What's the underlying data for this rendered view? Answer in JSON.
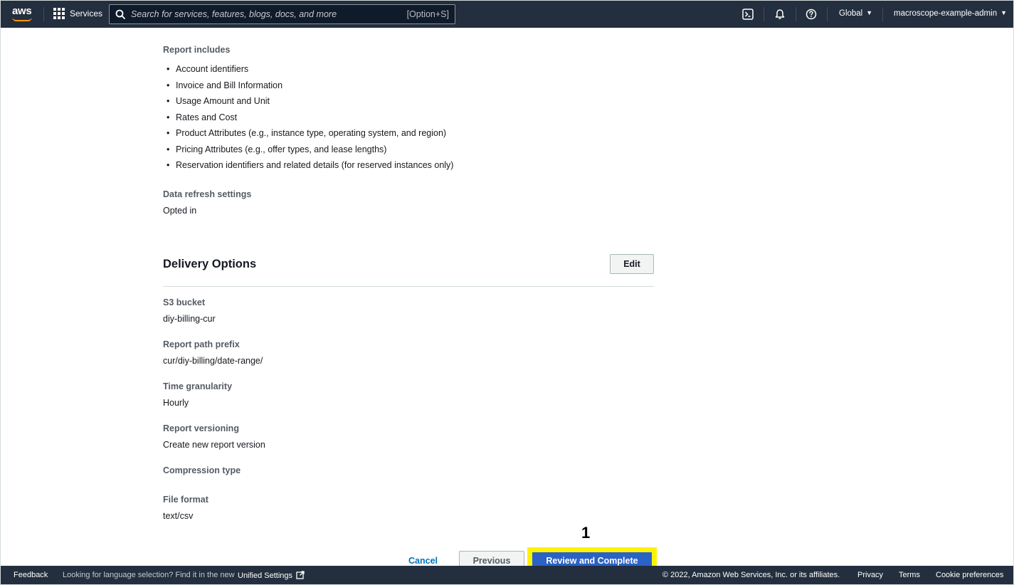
{
  "topnav": {
    "logo_text": "aws",
    "services_label": "Services",
    "search_placeholder": "Search for services, features, blogs, docs, and more",
    "search_shortcut": "[Option+S]",
    "region_label": "Global",
    "account_label": "macroscope-example-admin",
    "icons": [
      "cloudshell-icon",
      "bell-icon",
      "help-icon"
    ]
  },
  "report": {
    "includes_label": "Report includes",
    "includes_items": [
      "Account identifiers",
      "Invoice and Bill Information",
      "Usage Amount and Unit",
      "Rates and Cost",
      "Product Attributes (e.g., instance type, operating system, and region)",
      "Pricing Attributes (e.g., offer types, and lease lengths)",
      "Reservation identifiers and related details (for reserved instances only)"
    ],
    "refresh_label": "Data refresh settings",
    "refresh_value": "Opted in"
  },
  "delivery": {
    "title": "Delivery Options",
    "edit_label": "Edit",
    "s3_label": "S3 bucket",
    "s3_value": "diy-billing-cur",
    "prefix_label": "Report path prefix",
    "prefix_value": "cur/diy-billing/date-range/",
    "granularity_label": "Time granularity",
    "granularity_value": "Hourly",
    "versioning_label": "Report versioning",
    "versioning_value": "Create new report version",
    "compression_label": "Compression type",
    "compression_value": "",
    "format_label": "File format",
    "format_value": "text/csv"
  },
  "actions": {
    "step_marker": "1",
    "cancel_label": "Cancel",
    "previous_label": "Previous",
    "primary_label": "Review and Complete",
    "highlight_color": "#fff200",
    "primary_color": "#2a62c6"
  },
  "footer": {
    "feedback": "Feedback",
    "language_hint": "Looking for language selection? Find it in the new",
    "unified_settings": "Unified Settings",
    "copyright": "© 2022, Amazon Web Services, Inc. or its affiliates.",
    "privacy": "Privacy",
    "terms": "Terms",
    "cookies": "Cookie preferences"
  }
}
